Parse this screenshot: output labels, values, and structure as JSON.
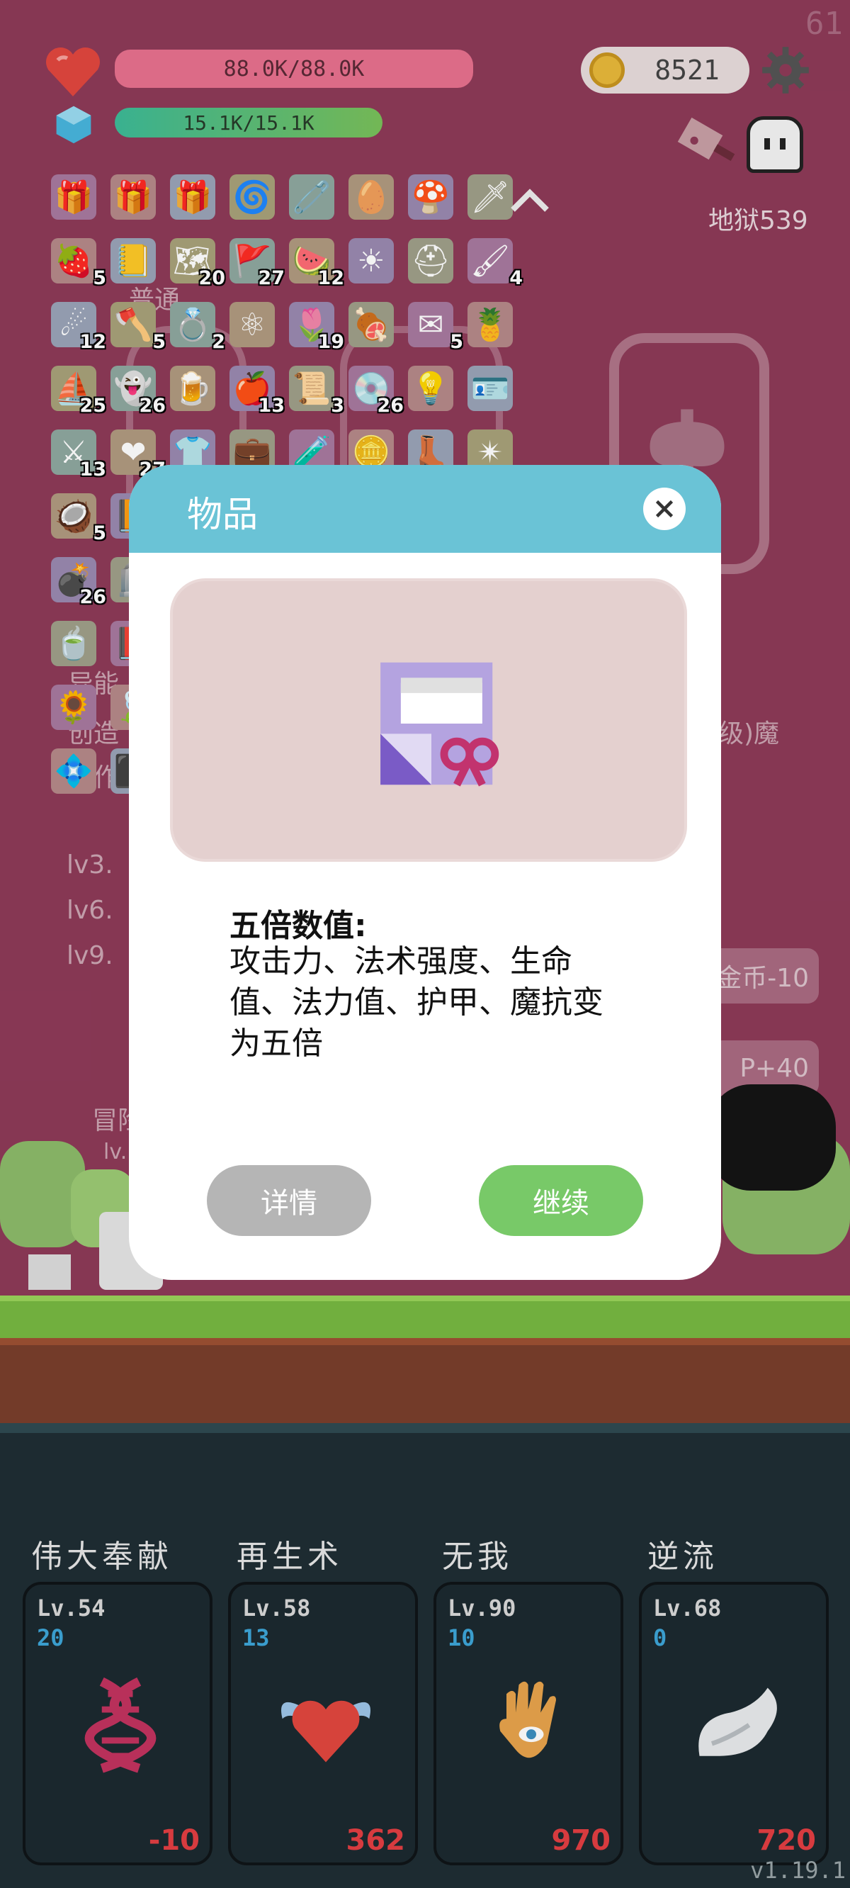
{
  "fps": "61",
  "hud": {
    "hp_text": "88.0K/88.0K",
    "mp_text": "15.1K/15.1K",
    "gold": "8521",
    "stage": "地狱539"
  },
  "inventory": {
    "rows": [
      [
        {
          "icon": "gift-note-icon"
        },
        {
          "icon": "gift-note-icon"
        },
        {
          "icon": "gift-note-icon"
        },
        {
          "icon": "spiral-icon"
        },
        {
          "icon": "safety-pin-icon"
        },
        {
          "icon": "egg-icon"
        },
        {
          "icon": "mushroom-icon"
        },
        {
          "icon": "sword-icon"
        }
      ],
      [
        {
          "icon": "strawberry-icon",
          "count": "5"
        },
        {
          "icon": "notebook-icon"
        },
        {
          "icon": "map-icon",
          "count": "20"
        },
        {
          "icon": "flag-icon",
          "count": "27"
        },
        {
          "icon": "watermelon-icon",
          "count": "12"
        },
        {
          "icon": "sun-icon"
        },
        {
          "icon": "viking-helmet-icon"
        },
        {
          "icon": "brush-icon",
          "count": "4"
        }
      ],
      [
        {
          "icon": "meteor-icon",
          "count": "12"
        },
        {
          "icon": "axe-icon",
          "count": "5"
        },
        {
          "icon": "ring-icon",
          "count": "2"
        },
        {
          "icon": "molecule-icon"
        },
        {
          "icon": "flower-icon",
          "count": "19"
        },
        {
          "icon": "meat-icon"
        },
        {
          "icon": "envelope-icon",
          "count": "5"
        },
        {
          "icon": "pineapple-icon"
        }
      ],
      [
        {
          "icon": "pirate-ship-icon",
          "count": "25"
        },
        {
          "icon": "ghost-icon",
          "count": "26"
        },
        {
          "icon": "beer-icon"
        },
        {
          "icon": "apple-icon",
          "count": "13"
        },
        {
          "icon": "scroll-icon",
          "count": "3"
        },
        {
          "icon": "disc-icon",
          "count": "26"
        },
        {
          "icon": "lightbulb-icon"
        },
        {
          "icon": "id-card-icon"
        }
      ],
      [
        {
          "icon": "blade-icon",
          "count": "13"
        },
        {
          "icon": "heart-icon",
          "count": "27"
        },
        {
          "icon": "shirt-icon"
        },
        {
          "icon": "bag-icon"
        },
        {
          "icon": "potion-icon"
        },
        {
          "icon": "coins-icon"
        },
        {
          "icon": "boot-icon"
        },
        {
          "icon": "mace-icon"
        }
      ],
      [
        {
          "icon": "coconut-icon",
          "count": "5"
        },
        {
          "icon": "book-icon"
        }
      ],
      [
        {
          "icon": "bomb-icon",
          "count": "26"
        },
        {
          "icon": "tombstone-icon"
        }
      ],
      [
        {
          "icon": "tea-cup-icon"
        },
        {
          "icon": "red-book-icon"
        }
      ],
      [
        {
          "icon": "sunflower-icon"
        },
        {
          "icon": "leaf-icon"
        }
      ],
      [
        {
          "icon": "gem-tile-icon"
        },
        {
          "icon": "dark-tile-icon"
        }
      ]
    ]
  },
  "background_texts": {
    "putong": "普通",
    "yineng": "异能",
    "chuangzao": "创造",
    "fazuo": "法作",
    "lv3": "lv3.",
    "lv6": "lv6.",
    "lv9": "lv9.",
    "magic": "级)魔",
    "gold_minus": "金币-10",
    "p_plus": "P+40",
    "maoxian": "冒险",
    "lvsmall": "lv."
  },
  "modal": {
    "title": "物品",
    "item_icon": "gift-note-icon",
    "desc_title": "五倍数值:",
    "desc_body": "攻击力、法术强度、生命值、法力值、护甲、魔抗变为五倍",
    "detail_button": "详情",
    "continue_button": "继续"
  },
  "skills": [
    {
      "name": "伟大奉献",
      "level": "Lv.54",
      "value": "20",
      "cost": "-10",
      "icon": "dna-icon"
    },
    {
      "name": "再生术",
      "level": "Lv.58",
      "value": "13",
      "cost": "362",
      "icon": "winged-heart-icon"
    },
    {
      "name": "无我",
      "level": "Lv.90",
      "value": "10",
      "cost": "970",
      "icon": "hamsa-hand-icon"
    },
    {
      "name": "逆流",
      "level": "Lv.68",
      "value": "0",
      "cost": "720",
      "icon": "wing-icon"
    }
  ],
  "version": "v1.19.1",
  "colors": {
    "background": "#8e3a58",
    "hp_bar": "#e8718f",
    "mp_bar": "#5ec07a",
    "modal_header": "#6ac3d6",
    "continue_button": "#78c968",
    "detail_button": "#b5b5b5",
    "skill_cost": "#e33f43",
    "skill_value": "#3ea6d8"
  }
}
